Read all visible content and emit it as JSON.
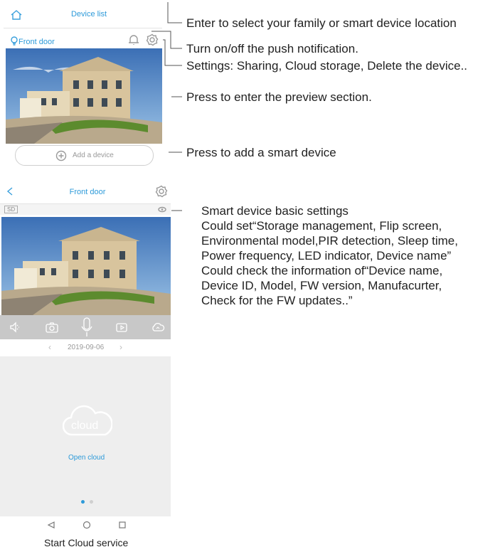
{
  "screen1": {
    "header_title": "Device list",
    "device_name": "Front door",
    "add_device_label": "Add a device"
  },
  "screen2": {
    "header_title": "Front door",
    "badge_text": "SD",
    "date": "2019-09-06",
    "cloud_text": "cloud",
    "open_cloud": "Open cloud"
  },
  "annotations": {
    "family": "Enter to select your family or smart device location",
    "push": "Turn on/off the push notification.",
    "settings": "Settings: Sharing, Cloud storage, Delete the device..",
    "preview": "Press to enter the preview section.",
    "add": "Press to add a smart device",
    "basic_1": "Smart device basic settings",
    "basic_2": "Could set“Storage management, Flip screen,",
    "basic_3": "Environmental model,PIR detection, Sleep time,",
    "basic_4": "Power frequency, LED indicator, Device name”",
    "basic_5": "Could check the information of“Device name,",
    "basic_6": "Device ID, Model, FW version, Manufacurter,",
    "basic_7": "Check for the FW updates..”"
  },
  "caption": "Start Cloud service",
  "colors": {
    "accent": "#2d9ad9",
    "toolbar": "#c8c8c8",
    "panel": "#eeeeee"
  }
}
